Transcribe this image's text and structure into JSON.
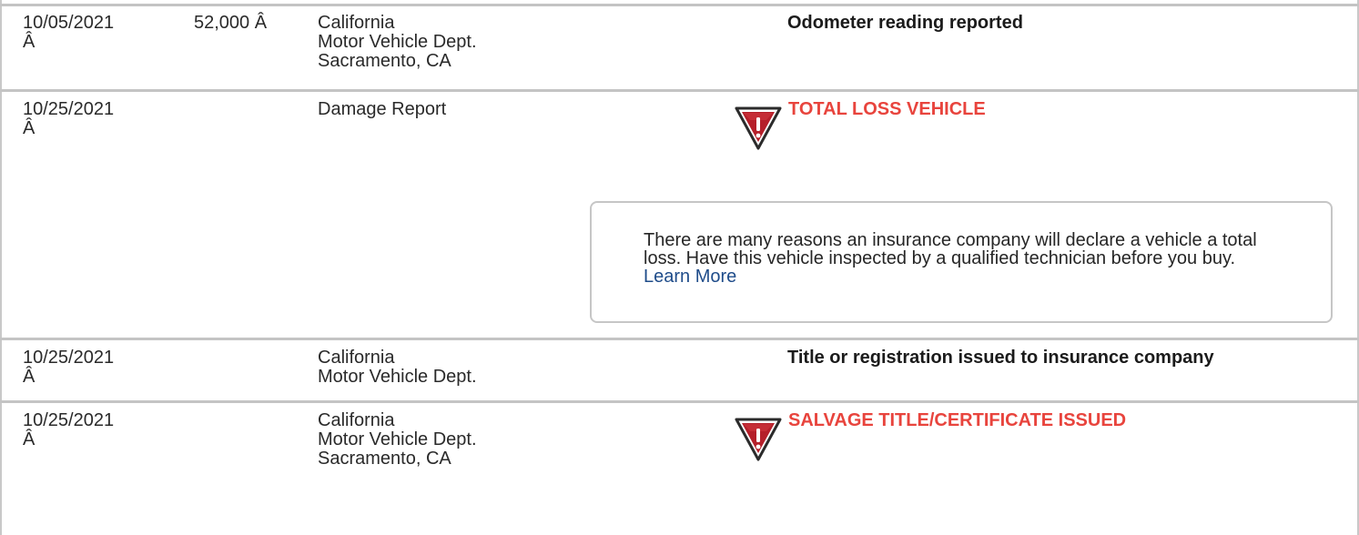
{
  "history": {
    "rows": [
      {
        "date": "10/05/2021",
        "date_suffix": "Â",
        "mileage": "52,000 Â",
        "source": [
          "California",
          "Motor Vehicle Dept.",
          "Sacramento, CA"
        ],
        "comment": "Odometer reading reported"
      },
      {
        "date": "10/25/2021",
        "date_suffix": "Â",
        "mileage": "",
        "source": [
          "Damage Report"
        ],
        "alert": "TOTAL LOSS VEHICLE",
        "icon": "warning-shield-icon",
        "note": {
          "text": "There are many reasons an insurance company will declare a vehicle a total loss. Have this vehicle inspected by a qualified technician before you buy.",
          "link": "Learn More"
        }
      },
      {
        "date": "10/25/2021",
        "date_suffix": "Â",
        "mileage": "",
        "source": [
          "California",
          "Motor Vehicle Dept."
        ],
        "comment": "Title or registration issued to insurance company"
      },
      {
        "date": "10/25/2021",
        "date_suffix": "Â",
        "mileage": "",
        "source": [
          "California",
          "Motor Vehicle Dept.",
          "Sacramento, CA"
        ],
        "alert": "SALVAGE TITLE/CERTIFICATE ISSUED",
        "icon": "warning-shield-icon"
      }
    ]
  },
  "colors": {
    "alert": "#e8443d",
    "icon_fill": "#b51f2a",
    "link": "#1f4c8a",
    "border": "#c4c4c4"
  }
}
